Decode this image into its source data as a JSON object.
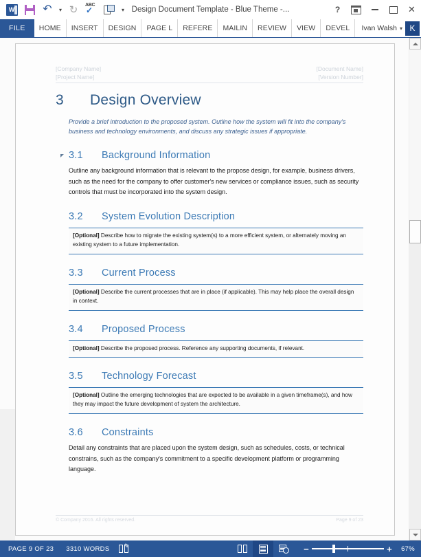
{
  "titlebar": {
    "quick_access": [
      {
        "name": "word-logo-icon",
        "label": "W"
      },
      {
        "name": "save-icon",
        "label": "Save"
      },
      {
        "name": "undo-icon",
        "label": "Undo"
      },
      {
        "name": "redo-icon",
        "label": "Redo"
      },
      {
        "name": "spelling-check-icon",
        "label": "ABC"
      },
      {
        "name": "touch-mouse-mode-icon",
        "label": "Touch/Mouse Mode"
      },
      {
        "name": "customize-qat-caret-icon",
        "label": "▾"
      }
    ],
    "title": "Design Document Template - Blue Theme -...",
    "window_controls": [
      {
        "name": "help-button",
        "label": "?"
      },
      {
        "name": "ribbon-display-options-button",
        "label": ""
      },
      {
        "name": "minimize-button",
        "label": ""
      },
      {
        "name": "maximize-button",
        "label": ""
      },
      {
        "name": "close-button",
        "label": "✕"
      }
    ]
  },
  "ribbon": {
    "file_tab": "FILE",
    "tabs": [
      "HOME",
      "INSERT",
      "DESIGN",
      "PAGE L",
      "REFERE",
      "MAILIN",
      "REVIEW",
      "VIEW",
      "DEVEL"
    ],
    "user_name": "Ivan Walsh",
    "user_caret": "▾",
    "avatar_initial": "K"
  },
  "document": {
    "header": {
      "left_line1": "[Company Name]",
      "left_line2": "[Project Name]",
      "right_line1": "[Document Name]",
      "right_line2": "[Version Number]"
    },
    "section": {
      "number": "3",
      "title": "Design Overview",
      "lead": "Provide a brief introduction to the proposed system. Outline how the system will fit into the company's business and technology environments, and discuss any strategic issues if appropriate."
    },
    "subsections": [
      {
        "number": "3.1",
        "title": "Background Information",
        "collapsible": true,
        "body": "Outline any background information that is relevant to the propose design, for example, business drivers, such as the need for the company to offer customer's new services or compliance issues, such as security controls that must be incorporated into the system design.",
        "optional": null
      },
      {
        "number": "3.2",
        "title": "System Evolution Description",
        "collapsible": false,
        "body": null,
        "optional_tag": "[Optional]",
        "optional": " Describe how to migrate the existing system(s) to a more efficient system, or alternately moving an existing system to a future implementation."
      },
      {
        "number": "3.3",
        "title": "Current Process",
        "collapsible": false,
        "body": null,
        "optional_tag": "[Optional]",
        "optional": " Describe the current processes that are in place (if applicable). This may help place the overall design in context."
      },
      {
        "number": "3.4",
        "title": "Proposed Process",
        "collapsible": false,
        "body": null,
        "optional_tag": "[Optional]",
        "optional": " Describe the proposed process. Reference any supporting documents, if relevant."
      },
      {
        "number": "3.5",
        "title": "Technology Forecast",
        "collapsible": false,
        "body": null,
        "optional_tag": "[Optional]",
        "optional": " Outline the emerging technologies that are expected to be available in a given timeframe(s), and how they may impact the future development of system the architecture."
      },
      {
        "number": "3.6",
        "title": "Constraints",
        "collapsible": false,
        "body": "Detail any constraints that are placed upon the system design, such as schedules, costs, or technical constrains, such as the company's commitment to a specific development platform or programming language.",
        "optional": null
      }
    ],
    "footer": {
      "left": "© Company 2016.  All rights reserved.",
      "right": "Page 9 of 23"
    }
  },
  "statusbar": {
    "page": "PAGE 9 OF 23",
    "words": "3310 WORDS",
    "proofing_icon": "proofing-errors-icon",
    "views": [
      {
        "name": "read-mode-view-button",
        "label": "Read Mode",
        "active": false
      },
      {
        "name": "print-layout-view-button",
        "label": "Print Layout",
        "active": true
      },
      {
        "name": "web-layout-view-button",
        "label": "Web Layout",
        "active": false
      }
    ],
    "zoom_out": "−",
    "zoom_in": "+",
    "zoom_level": "67%"
  },
  "colors": {
    "accent": "#2b5797",
    "heading": "#2e5a87",
    "subheading": "#3c7ab5",
    "status_bar": "#2b5797"
  }
}
